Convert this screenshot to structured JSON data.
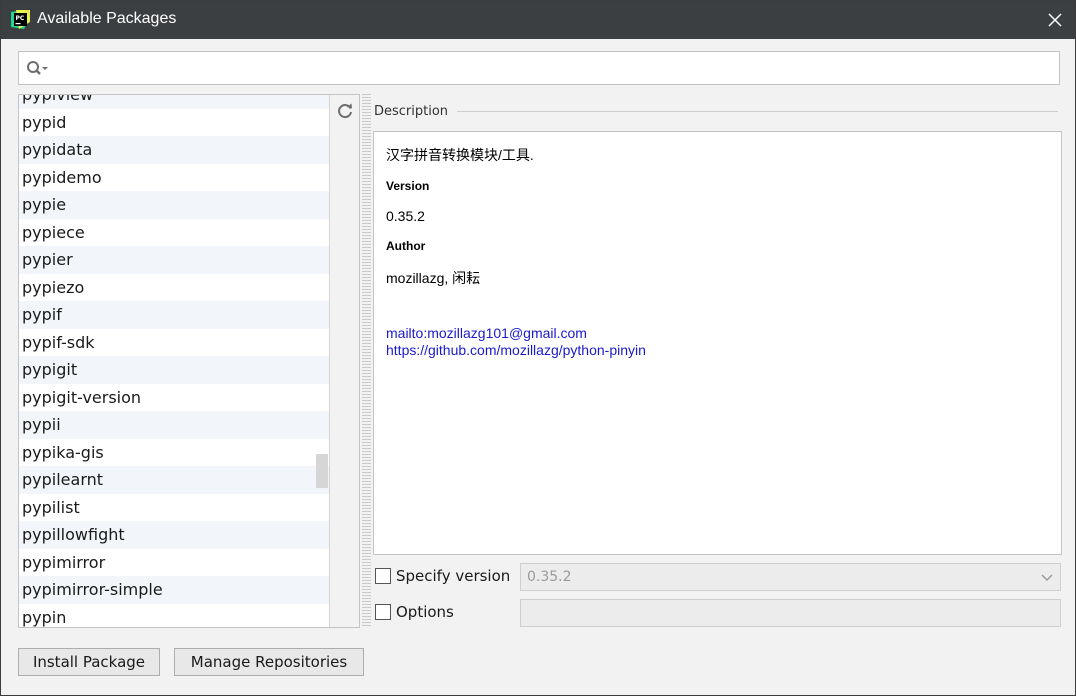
{
  "window": {
    "title": "Available Packages",
    "app_icon_text": "PC"
  },
  "search": {
    "value": "",
    "placeholder": ""
  },
  "package_list": {
    "partial_top_item": "pypiview",
    "items": [
      "pypid",
      "pypidata",
      "pypidemo",
      "pypie",
      "pypiece",
      "pypier",
      "pypiezo",
      "pypif",
      "pypif-sdk",
      "pypigit",
      "pypigit-version",
      "pypii",
      "pypika-gis",
      "pypilearnt",
      "pypilist",
      "pypillowfight",
      "pypimirror",
      "pypimirror-simple",
      "pypin"
    ],
    "scroll_fraction": 0.72
  },
  "description": {
    "section_label": "Description",
    "summary": "汉字拼音转换模块/工具.",
    "version_label": "Version",
    "version_value": "0.35.2",
    "author_label": "Author",
    "author_value": "mozillazg, 闲耘",
    "links": [
      "mailto:mozillazg101@gmail.com",
      "https://github.com/mozillazg/python-pinyin"
    ]
  },
  "specify_version": {
    "label": "Specify version",
    "checked": false,
    "selected_value": "0.35.2"
  },
  "options": {
    "label": "Options",
    "checked": false,
    "value": ""
  },
  "buttons": {
    "install": "Install Package",
    "manage": "Manage Repositories"
  },
  "colors": {
    "titlebar": "#3c3f41",
    "link": "#1a1acc",
    "row_alt": "#f2f5f9"
  },
  "icons": {
    "app": "pycharm-icon",
    "close": "close-icon",
    "search": "search-icon",
    "refresh": "refresh-icon",
    "dropdown": "chevron-down-icon"
  }
}
